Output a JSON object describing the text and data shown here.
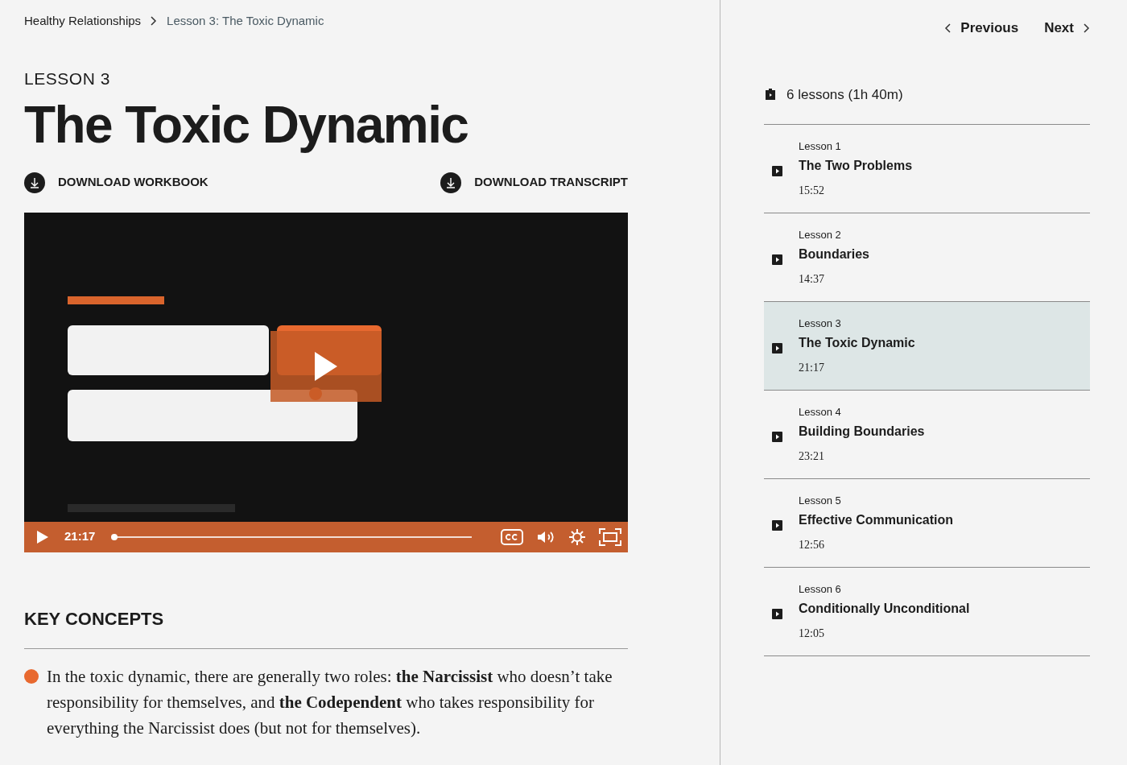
{
  "breadcrumb": [
    {
      "label": "Healthy Relationships",
      "selected": false
    },
    {
      "label": "Lesson 3: The Toxic Dynamic",
      "selected": true
    }
  ],
  "eyebrow": "LESSON 3",
  "title": "The Toxic Dynamic",
  "downloads": [
    "DOWNLOAD WORKBOOK",
    "DOWNLOAD TRANSCRIPT"
  ],
  "video": {
    "kind": "picture",
    "time": "21:17",
    "level": 0
  },
  "key_concepts": {
    "heading": "KEY CONCEPTS",
    "items": [
      "In the toxic dynamic, there are generally two roles: **the Narcissist** who doesn’t take responsibility for themselves, and **the Codependent** who takes responsibility for everything the Narcissist does (but not for themselves)."
    ]
  },
  "nav": {
    "previous": "Previous",
    "next": "Next"
  },
  "summary": "6 lessons (1h 40m)",
  "lessons": [
    {
      "number": "Lesson 1",
      "title": "The Two Problems",
      "duration": "15:52",
      "selected": false
    },
    {
      "number": "Lesson 2",
      "title": "Boundaries",
      "duration": "14:37",
      "selected": false
    },
    {
      "number": "Lesson 3",
      "title": "The Toxic Dynamic",
      "duration": "21:17",
      "selected": true
    },
    {
      "number": "Lesson 4",
      "title": "Building Boundaries",
      "duration": "23:21",
      "selected": false
    },
    {
      "number": "Lesson 5",
      "title": "Effective Communication",
      "duration": "12:56",
      "selected": false
    },
    {
      "number": "Lesson 6",
      "title": "Conditionally Unconditional",
      "duration": "12:05",
      "selected": false
    }
  ]
}
